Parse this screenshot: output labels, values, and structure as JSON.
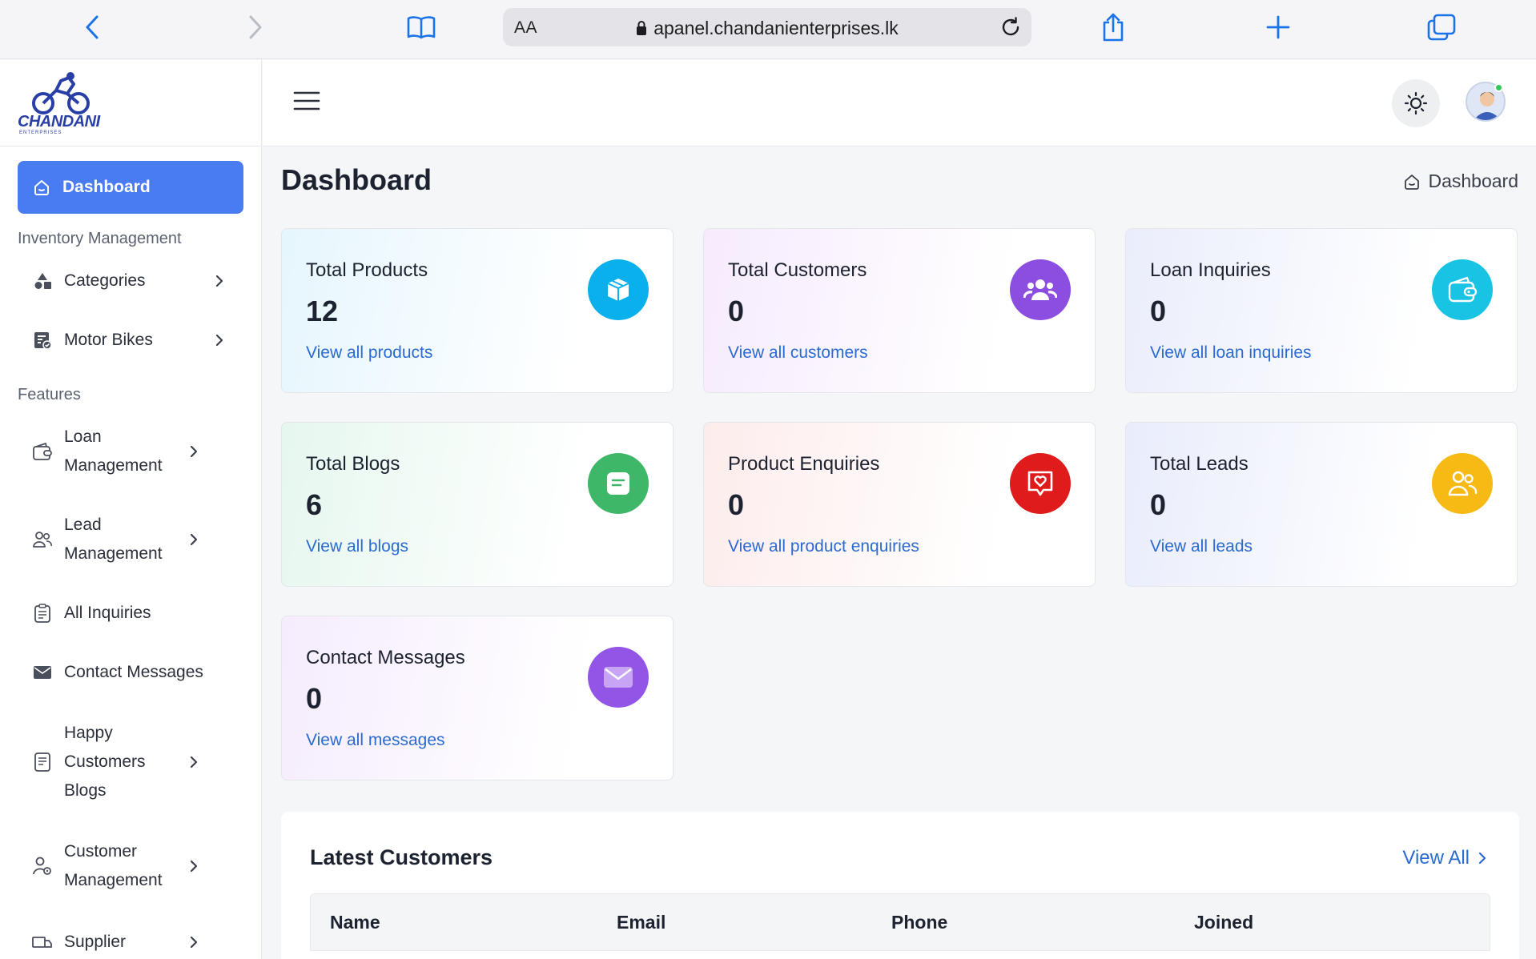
{
  "browser": {
    "text_size_label": "AA",
    "url": "apanel.chandanienterprises.lk"
  },
  "brand": {
    "name": "CHANDANI",
    "tagline": "ENTERPRISES"
  },
  "sidebar": {
    "active": {
      "label": "Dashboard",
      "icon": "home-icon"
    },
    "sections": [
      {
        "title": "Inventory Management",
        "items": [
          {
            "label": "Categories",
            "icon": "shapes-icon",
            "has_children": true
          },
          {
            "label": "Motor Bikes",
            "icon": "list-check-icon",
            "has_children": true
          }
        ]
      },
      {
        "title": "Features",
        "items": [
          {
            "label": "Loan Management",
            "icon": "wallet-icon",
            "has_children": true
          },
          {
            "label": "Lead Management",
            "icon": "users-icon",
            "has_children": true
          },
          {
            "label": "All Inquiries",
            "icon": "clipboard-icon",
            "has_children": false
          },
          {
            "label": "Contact Messages",
            "icon": "envelope-icon",
            "has_children": false
          },
          {
            "label": "Happy Customers Blogs",
            "icon": "document-icon",
            "has_children": true
          },
          {
            "label": "Customer Management",
            "icon": "user-gear-icon",
            "has_children": true
          },
          {
            "label": "Supplier",
            "icon": "truck-icon",
            "has_children": true
          }
        ]
      }
    ]
  },
  "page": {
    "title": "Dashboard",
    "breadcrumb": "Dashboard"
  },
  "cards": [
    {
      "label": "Total Products",
      "value": "12",
      "link": "View all products",
      "icon": "box-icon",
      "color": "#0ab0ec"
    },
    {
      "label": "Total Customers",
      "value": "0",
      "link": "View all customers",
      "icon": "users-icon",
      "color": "#8b4ee0"
    },
    {
      "label": "Loan Inquiries",
      "value": "0",
      "link": "View all loan inquiries",
      "icon": "wallet-icon",
      "color": "#18c3e3"
    },
    {
      "label": "Total Blogs",
      "value": "6",
      "link": "View all blogs",
      "icon": "note-icon",
      "color": "#3fb769"
    },
    {
      "label": "Product Enquiries",
      "value": "0",
      "link": "View all product enquiries",
      "icon": "heart-chat-icon",
      "color": "#e01b1b"
    },
    {
      "label": "Total Leads",
      "value": "0",
      "link": "View all leads",
      "icon": "users-icon",
      "color": "#f7b913"
    },
    {
      "label": "Contact Messages",
      "value": "0",
      "link": "View all messages",
      "icon": "envelope-icon",
      "color": "#9355e6"
    }
  ],
  "latest_customers": {
    "title": "Latest Customers",
    "view_all": "View All",
    "columns": [
      "Name",
      "Email",
      "Phone",
      "Joined"
    ]
  }
}
